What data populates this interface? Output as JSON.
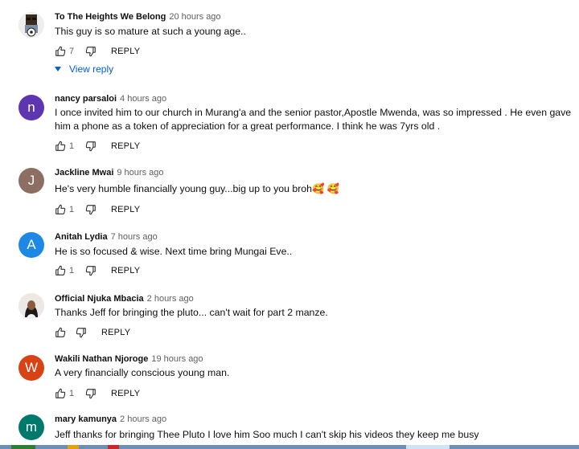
{
  "comments": [
    {
      "author": "To The Heights We Belong",
      "time": "20 hours ago",
      "text": "This guy is so mature at such a young age..",
      "likes": "7",
      "reply": "REPLY",
      "avatar": {
        "kind": "image",
        "icon": "soccer-player-avatar-icon"
      }
    },
    {
      "author": "nancy parsaloi",
      "time": "4 hours ago",
      "text": "I once invited him to our church in Murang'a and the senior pastor,Apostle Mwenda, was so impressed . He even gave him a phone as a token of appreciation for a great performance. I think he was 7yrs old .",
      "likes": "1",
      "reply": "REPLY",
      "avatar": {
        "kind": "letter",
        "letter": "n",
        "color": "#5e35b1"
      }
    },
    {
      "author": "Jackline Mwai",
      "time": "9 hours ago",
      "text": "He's very humble financially young guy...big up to you broh",
      "emoji": "🥰 🥰",
      "likes": "1",
      "reply": "REPLY",
      "avatar": {
        "kind": "letter",
        "letter": "J",
        "color": "#8d6e63"
      }
    },
    {
      "author": "Anitah Lydia",
      "time": "7 hours ago",
      "text": "He is so focused & wise. Next time bring Mungai Eve..",
      "likes": "1",
      "reply": "REPLY",
      "avatar": {
        "kind": "letter",
        "letter": "A",
        "color": "#1e88e5"
      }
    },
    {
      "author": "Official Njuka Mbacia",
      "time": "2 hours ago",
      "text": "Thanks Jeff for bringing the pluto... can't wait for part 2 manze.",
      "likes": "",
      "reply": "REPLY",
      "avatar": {
        "kind": "image",
        "icon": "woman-portrait-avatar-icon"
      }
    },
    {
      "author": "Wakili Nathan Njoroge",
      "time": "19 hours ago",
      "text": "A very financially conscious young man.",
      "likes": "1",
      "reply": "REPLY",
      "avatar": {
        "kind": "letter",
        "letter": "W",
        "color": "#d84315"
      }
    },
    {
      "author": "mary kamunya",
      "time": "2 hours ago",
      "text": "Jeff thanks for bringing Thee Pluto  I love him Soo much I can't skip his videos they keep me busy",
      "likes": "",
      "reply": "REPLY",
      "avatar": {
        "kind": "letter",
        "letter": "m",
        "color": "#00796b"
      }
    }
  ],
  "view_replies": {
    "label": "View reply",
    "color": "#065fd4"
  },
  "icons": {
    "like": "thumb-up-icon",
    "dislike": "thumb-down-icon",
    "expand": "caret-down-icon"
  }
}
